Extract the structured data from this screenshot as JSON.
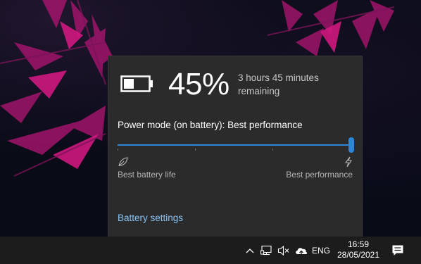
{
  "flyout": {
    "percent_text": "45%",
    "battery_level": 0.45,
    "remaining_line1": "3 hours 45 minutes",
    "remaining_line2": "remaining",
    "power_mode_label": "Power mode (on battery): Best performance",
    "slider_value": 1.0,
    "slider_min_label": "Best battery life",
    "slider_max_label": "Best performance",
    "battery_settings_link": "Battery settings",
    "accent_color": "#2d87d8",
    "link_color": "#8ac4f5"
  },
  "taskbar": {
    "language": "ENG",
    "time": "16:59",
    "date": "28/05/2021",
    "icons": [
      "chevron-up-icon",
      "network-icon",
      "volume-muted-icon",
      "onedrive-cloud-icon",
      "notification-icon"
    ]
  }
}
